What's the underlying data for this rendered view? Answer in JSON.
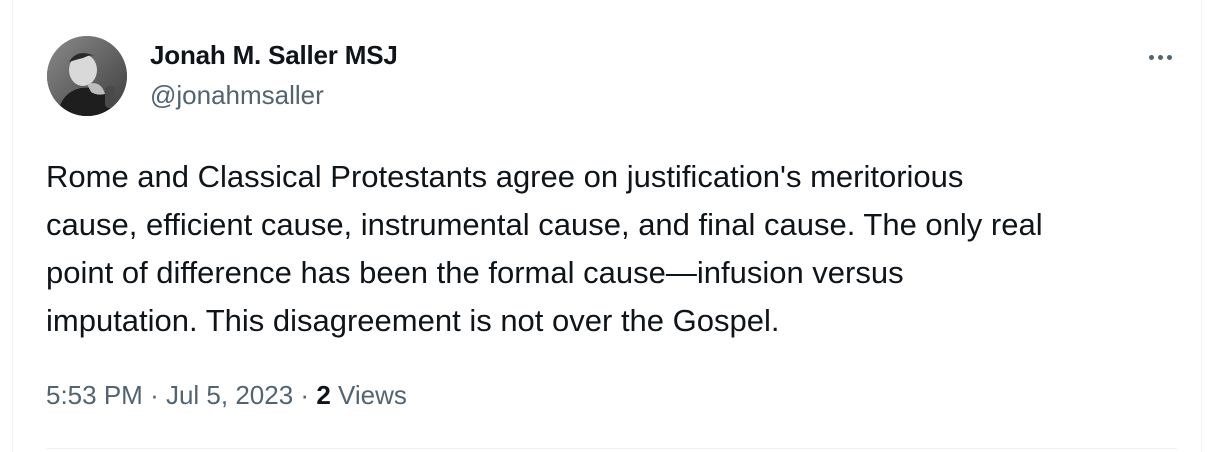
{
  "author": {
    "display_name": "Jonah M. Saller MSJ",
    "handle": "@jonahmsaller",
    "avatar_icon": "profile-photo"
  },
  "more_icon": "more-horizontal-icon",
  "tweet": {
    "text": "Rome and Classical Protestants agree on justification's meritorious\ncause, efficient cause, instrumental cause, and final cause. The only real\npoint of difference has been the formal cause—infusion versus\nimputation. This disagreement is not over the Gospel."
  },
  "meta": {
    "time": "5:53 PM",
    "separator": "·",
    "date": "Jul 5, 2023",
    "views_count": "2",
    "views_label": "Views"
  },
  "colors": {
    "text_primary": "#0f1419",
    "text_secondary": "#536471",
    "border": "#eff3f4"
  }
}
